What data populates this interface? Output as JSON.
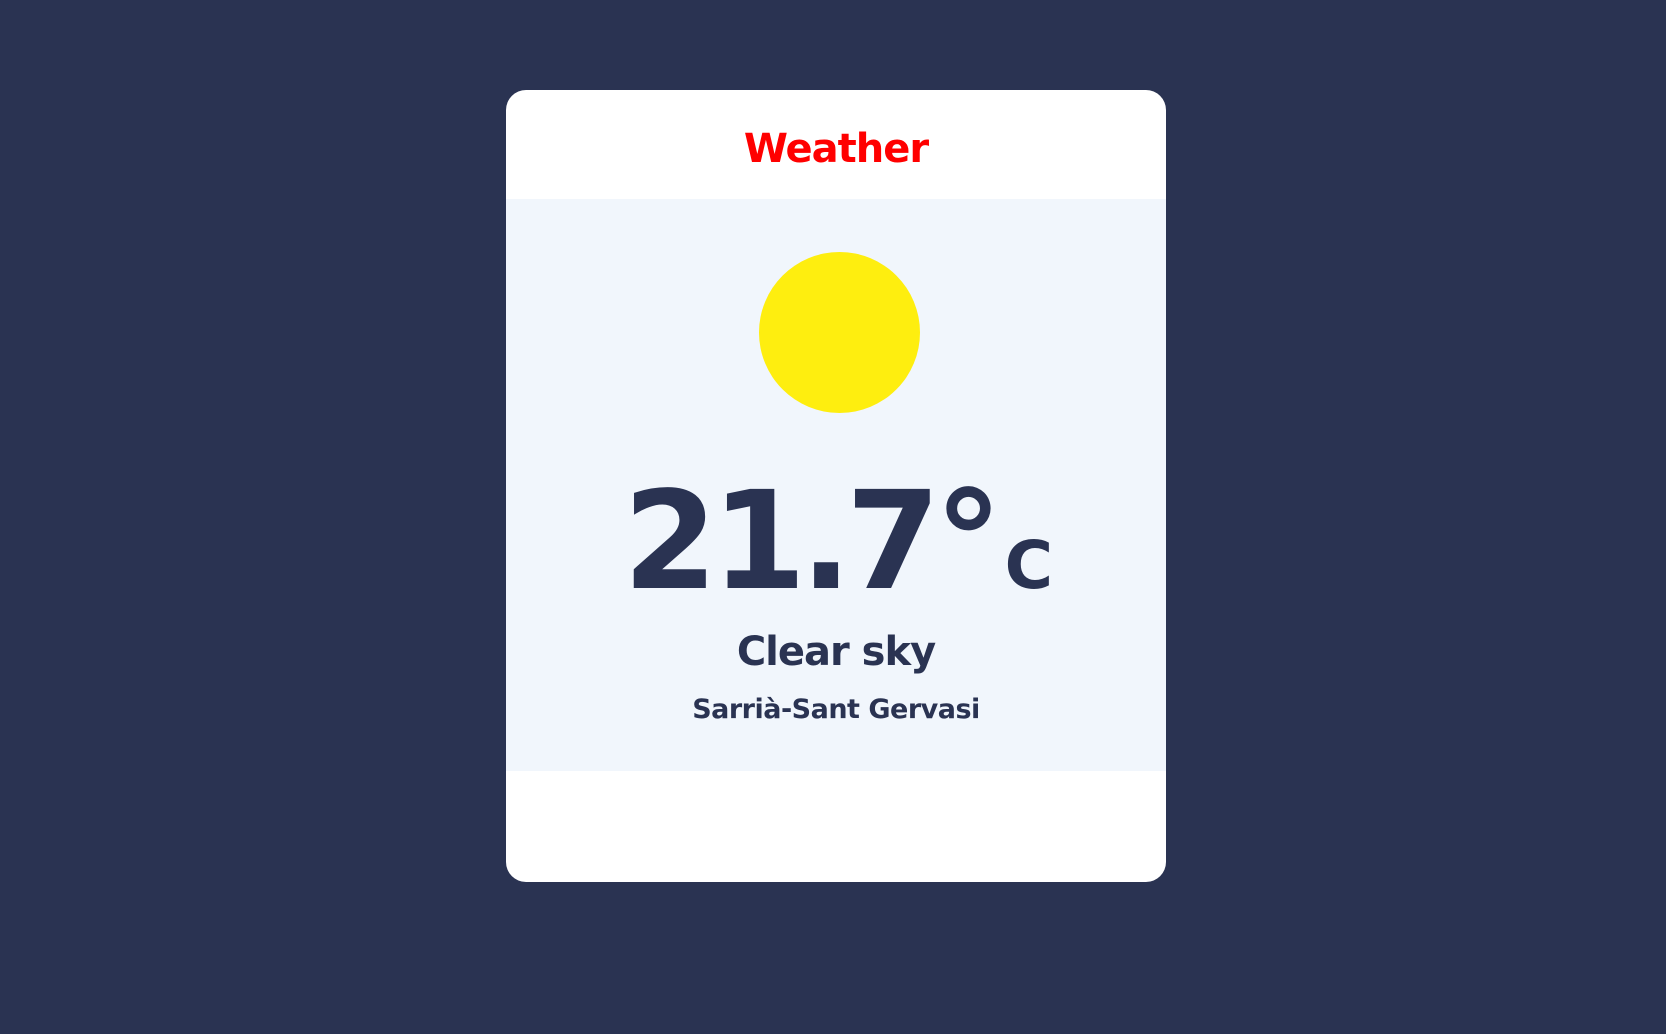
{
  "app": {
    "title": "Weather"
  },
  "weather": {
    "temperature": "21.7°",
    "unit": "C",
    "condition": "Clear sky",
    "location": "Sarrià-Sant Gervasi",
    "icon": "sun-icon"
  },
  "colors": {
    "background": "#2a3352",
    "title": "#ff0000",
    "sun": "#feee0f",
    "panel": "#f1f6fc",
    "text": "#2a3352"
  }
}
